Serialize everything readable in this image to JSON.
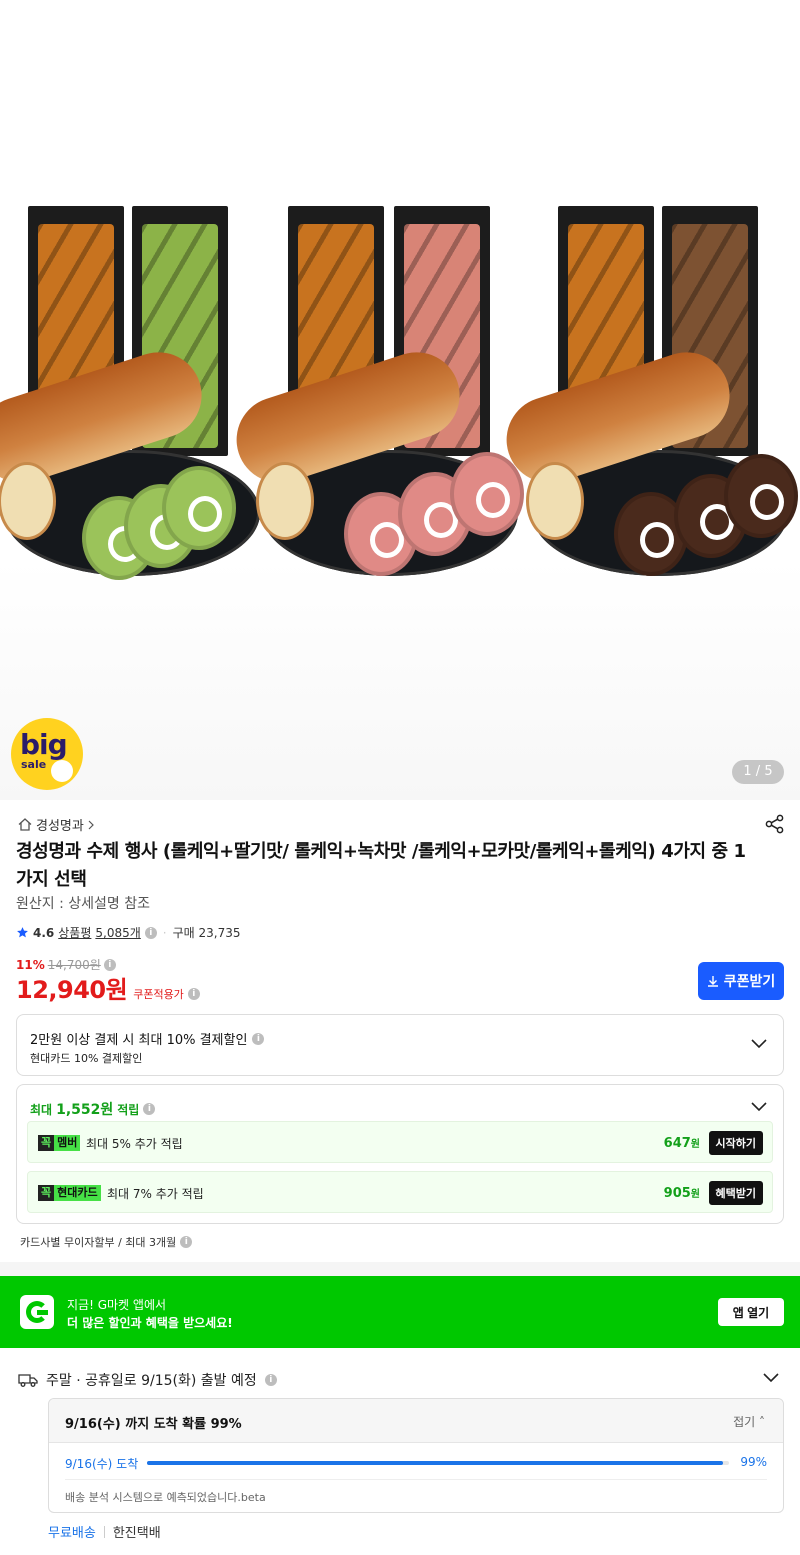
{
  "hero": {
    "badge_big": "big",
    "badge_sale": "sale",
    "pager": "1 / 5"
  },
  "product": {
    "store": "경성명과",
    "title": "경성명과 수제 행사 (롤케익+딸기맛/ 롤케익+녹차맛 /롤케익+모카맛/롤케익+롤케익) 4가지 중 1가지 선택",
    "origin": "원산지 : 상세설명 참조",
    "rating": "4.6",
    "review_label": "상품평",
    "review_count": "5,085개",
    "purchase": "구매 23,735",
    "discount_pct": "11%",
    "original_price": "14,700원",
    "price": "12,940원",
    "coupon_note": "쿠폰적용가",
    "coupon_button": "쿠폰받기"
  },
  "payment": {
    "line1": "2만원 이상 결제 시 최대 10% 결제할인",
    "line2": "현대카드 10% 결제할인"
  },
  "points": {
    "prefix": "최대",
    "amount": "1,552원",
    "suffix": "적립",
    "rows": [
      {
        "tag_k": "꼭",
        "tag_name": "멤버",
        "desc": "최대 5% 추가 적립",
        "value": "647",
        "unit": "원",
        "action": "시작하기"
      },
      {
        "tag_k": "꼭",
        "tag_name": "현대카드",
        "desc": "최대 7% 추가 적립",
        "value": "905",
        "unit": "원",
        "action": "혜택받기"
      }
    ],
    "installment": "카드사별 무이자할부 / 최대 3개월"
  },
  "app_banner": {
    "line1": "지금! G마켓 앱에서",
    "line2": "더 많은 할인과 혜택을 받으세요!",
    "button": "앱 열기"
  },
  "shipping": {
    "summary": "주말 · 공휴일로 9/15(화) 출발 예정",
    "probability_title": "9/16(수) 까지 도착 확률 99%",
    "fold": "접기",
    "row_date": "9/16(수) 도착",
    "row_pct": "99%",
    "row_value": 0.99,
    "note": "배송 분석 시스템으로 예측되었습니다.beta",
    "free": "무료배송",
    "carrier": "한진택배"
  },
  "colors": {
    "price_red": "#e21b1b",
    "coupon_blue": "#1a5cff",
    "gmarket_green": "#00c800",
    "points_green": "#13a01a"
  }
}
